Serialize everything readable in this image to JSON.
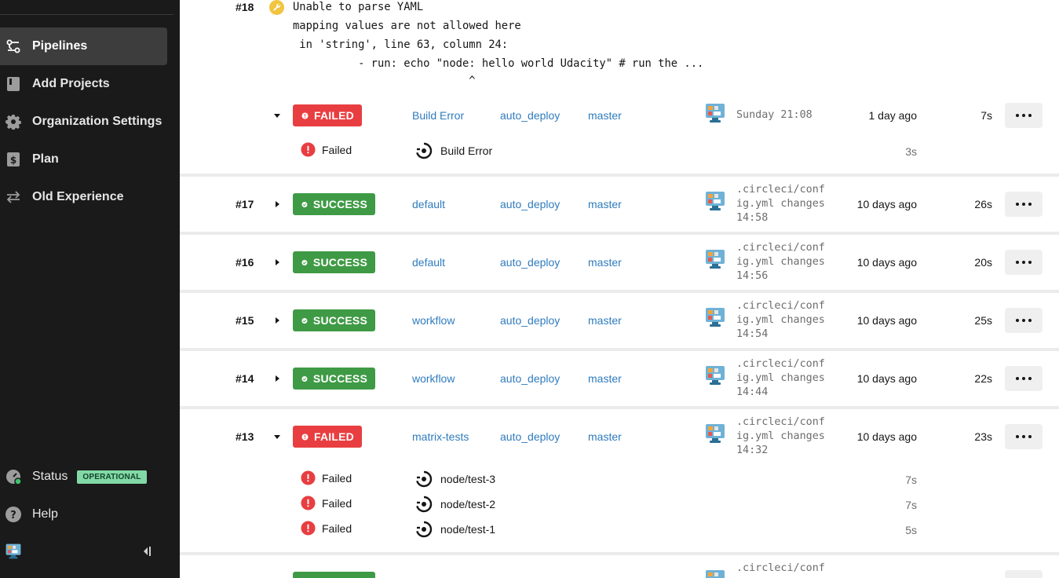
{
  "sidebar": {
    "items": [
      {
        "label": "Pipelines",
        "icon": "pipelines-icon",
        "active": true
      },
      {
        "label": "Add Projects",
        "icon": "book-icon",
        "active": false
      },
      {
        "label": "Organization Settings",
        "icon": "gear-icon",
        "active": false
      },
      {
        "label": "Plan",
        "icon": "dollar-icon",
        "active": false
      },
      {
        "label": "Old Experience",
        "icon": "swap-icon",
        "active": false
      }
    ],
    "status_label": "Status",
    "status_badge": "OPERATIONAL",
    "help_label": "Help"
  },
  "error_pipeline": {
    "number": "#18",
    "lines": [
      "Unable to parse YAML",
      "mapping values are not allowed here",
      " in 'string', line 63, column 24:",
      "          - run: echo \"node: hello world Udacity\" # run the ...",
      "                           ^"
    ],
    "status": "FAILED",
    "workflow": "Build Error",
    "project": "auto_deploy",
    "branch": "master",
    "commit": "Sunday 21:08",
    "ago": "1 day ago",
    "duration": "7s",
    "jobs": [
      {
        "status": "Failed",
        "name": "Build Error",
        "duration": "3s"
      }
    ]
  },
  "pipelines": [
    {
      "number": "#17",
      "status": "SUCCESS",
      "workflow": "default",
      "project": "auto_deploy",
      "branch": "master",
      "commit": ".circleci/conf\nig.yml changes\n14:58",
      "ago": "10 days ago",
      "duration": "26s"
    },
    {
      "number": "#16",
      "status": "SUCCESS",
      "workflow": "default",
      "project": "auto_deploy",
      "branch": "master",
      "commit": ".circleci/conf\nig.yml changes\n14:56",
      "ago": "10 days ago",
      "duration": "20s"
    },
    {
      "number": "#15",
      "status": "SUCCESS",
      "workflow": "workflow",
      "project": "auto_deploy",
      "branch": "master",
      "commit": ".circleci/conf\nig.yml changes\n14:54",
      "ago": "10 days ago",
      "duration": "25s"
    },
    {
      "number": "#14",
      "status": "SUCCESS",
      "workflow": "workflow",
      "project": "auto_deploy",
      "branch": "master",
      "commit": ".circleci/conf\nig.yml changes\n14:44",
      "ago": "10 days ago",
      "duration": "22s"
    },
    {
      "number": "#13",
      "status": "FAILED",
      "workflow": "matrix-tests",
      "project": "auto_deploy",
      "branch": "master",
      "commit": ".circleci/conf\nig.yml changes\n14:32",
      "ago": "10 days ago",
      "duration": "23s"
    }
  ],
  "matrix_jobs": [
    {
      "status": "Failed",
      "name": "node/test-3",
      "duration": "7s"
    },
    {
      "status": "Failed",
      "name": "node/test-2",
      "duration": "7s"
    },
    {
      "status": "Failed",
      "name": "node/test-1",
      "duration": "5s"
    }
  ],
  "partial_row": {
    "commit": ".circleci/conf"
  },
  "colors": {
    "success": "#3f9a45",
    "failed": "#e83e41",
    "link": "#2f7bbd",
    "sidebar": "#1a1a1a",
    "warning": "#f2c440"
  }
}
